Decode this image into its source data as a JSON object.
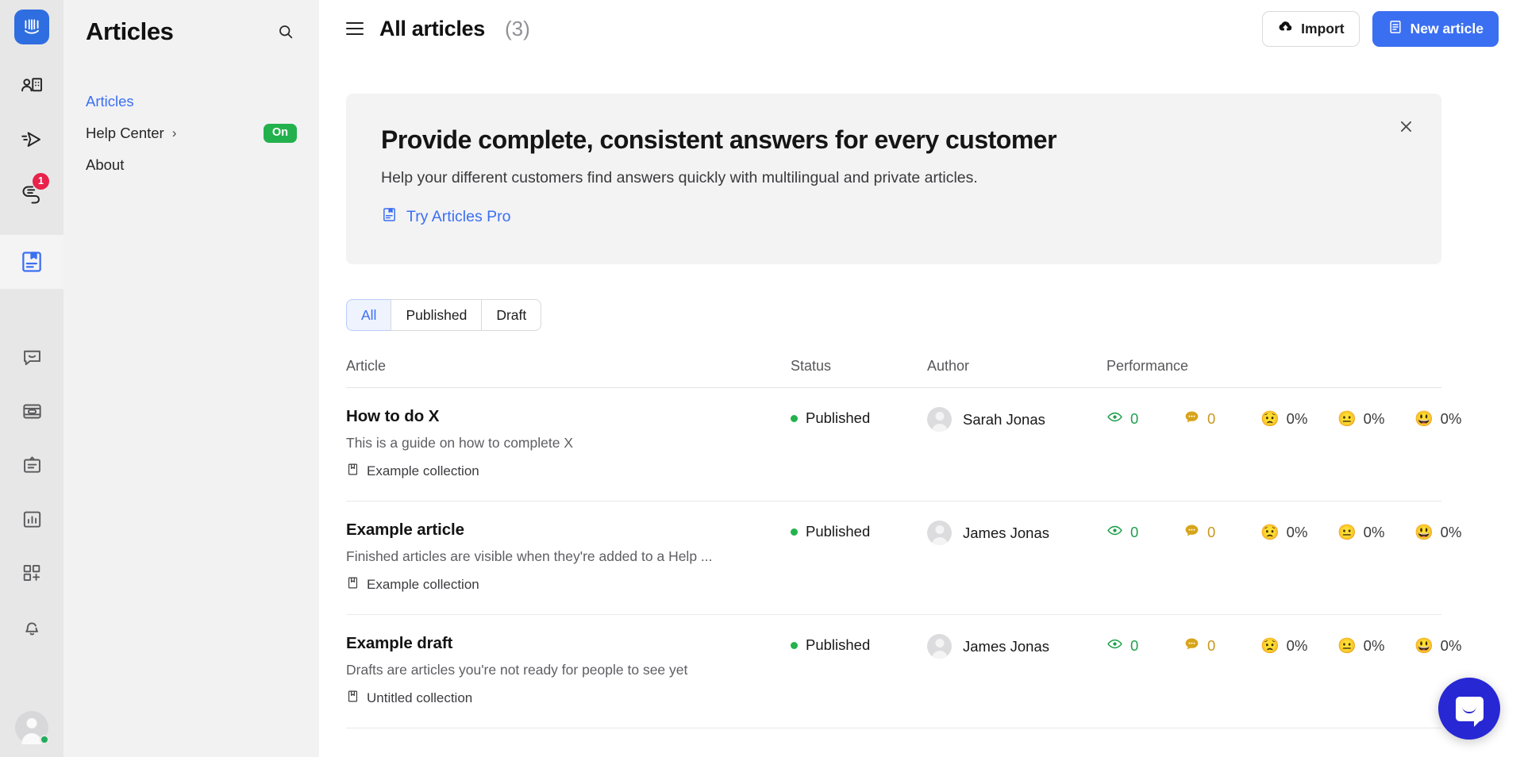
{
  "rail": {
    "logo_icon": "intercom-logo-icon",
    "items": [
      {
        "icon": "contacts-icon",
        "name": "contacts",
        "badge": null,
        "active": false
      },
      {
        "icon": "outbound-send-icon",
        "name": "outbound",
        "badge": null,
        "active": false
      },
      {
        "icon": "inbox-conversations-icon",
        "name": "inbox",
        "badge": "1",
        "active": false
      },
      {
        "icon": "articles-doc-icon",
        "name": "articles",
        "badge": null,
        "active": true
      },
      {
        "icon": "messenger-chat-icon",
        "name": "messenger",
        "badge": null,
        "active": false
      },
      {
        "icon": "tours-card-icon",
        "name": "tours",
        "badge": null,
        "active": false
      },
      {
        "icon": "clipboard-survey-icon",
        "name": "surveys",
        "badge": null,
        "active": false
      },
      {
        "icon": "reports-bar-chart-icon",
        "name": "reports",
        "badge": null,
        "active": false
      },
      {
        "icon": "apps-grid-plus-icon",
        "name": "app-store",
        "badge": null,
        "active": false
      },
      {
        "icon": "bell-notifications-icon",
        "name": "notifications",
        "badge": null,
        "active": false
      }
    ],
    "avatar": {
      "name": "user-avatar",
      "presence": "online",
      "presence_color": "#21ac5b"
    }
  },
  "sidebar": {
    "title": "Articles",
    "search_icon": "search-icon",
    "items": [
      {
        "label": "Articles",
        "active": true,
        "chevron": false,
        "badge": null
      },
      {
        "label": "Help Center",
        "active": false,
        "chevron": true,
        "badge": "On"
      },
      {
        "label": "About",
        "active": false,
        "chevron": false,
        "badge": null
      }
    ]
  },
  "topbar": {
    "menu_icon": "hamburger-menu-icon",
    "title": "All articles",
    "count": "(3)",
    "import_label": "Import",
    "import_icon": "cloud-upload-icon",
    "new_article_label": "New article",
    "new_article_icon": "document-icon"
  },
  "banner": {
    "heading": "Provide complete, consistent answers for every customer",
    "body": "Help your different customers find answers quickly with multilingual and private articles.",
    "link_label": "Try Articles Pro",
    "link_icon": "articles-doc-icon",
    "close_icon": "close-icon",
    "accent_color": "#3b6ff2",
    "background": "#f3f3f4"
  },
  "filters": {
    "options": [
      {
        "label": "All",
        "active": true
      },
      {
        "label": "Published",
        "active": false
      },
      {
        "label": "Draft",
        "active": false
      }
    ]
  },
  "table": {
    "columns": [
      "Article",
      "Status",
      "Author",
      "Performance"
    ],
    "rows": [
      {
        "title": "How to do X",
        "description": "This is a guide on how to complete X",
        "collection": "Example collection",
        "collection_icon": "collection-book-icon",
        "status": "Published",
        "status_color": "#24b24c",
        "author": "Sarah Jonas",
        "metrics": [
          {
            "icon": "eye-icon",
            "value": "0"
          },
          {
            "icon": "comment-bubble-icon",
            "value": "0"
          },
          {
            "icon": "sad-face-emoji",
            "value": "0%"
          },
          {
            "icon": "neutral-face-emoji",
            "value": "0%"
          },
          {
            "icon": "happy-face-emoji",
            "value": "0%"
          }
        ]
      },
      {
        "title": "Example article",
        "description": "Finished articles are visible when they're added to a Help ...",
        "collection": "Example collection",
        "collection_icon": "collection-book-icon",
        "status": "Published",
        "status_color": "#24b24c",
        "author": "James Jonas",
        "metrics": [
          {
            "icon": "eye-icon",
            "value": "0"
          },
          {
            "icon": "comment-bubble-icon",
            "value": "0"
          },
          {
            "icon": "sad-face-emoji",
            "value": "0%"
          },
          {
            "icon": "neutral-face-emoji",
            "value": "0%"
          },
          {
            "icon": "happy-face-emoji",
            "value": "0%"
          }
        ]
      },
      {
        "title": "Example draft",
        "description": "Drafts are articles you're not ready for people to see yet",
        "collection": "Untitled collection",
        "collection_icon": "collection-book-icon",
        "status": "Published",
        "status_color": "#24b24c",
        "author": "James Jonas",
        "metrics": [
          {
            "icon": "eye-icon",
            "value": "0"
          },
          {
            "icon": "comment-bubble-icon",
            "value": "0"
          },
          {
            "icon": "sad-face-emoji",
            "value": "0%"
          },
          {
            "icon": "neutral-face-emoji",
            "value": "0%"
          },
          {
            "icon": "happy-face-emoji",
            "value": "0%"
          }
        ]
      }
    ]
  },
  "launcher": {
    "icon": "messenger-launcher-icon",
    "color": "#2727d4"
  }
}
